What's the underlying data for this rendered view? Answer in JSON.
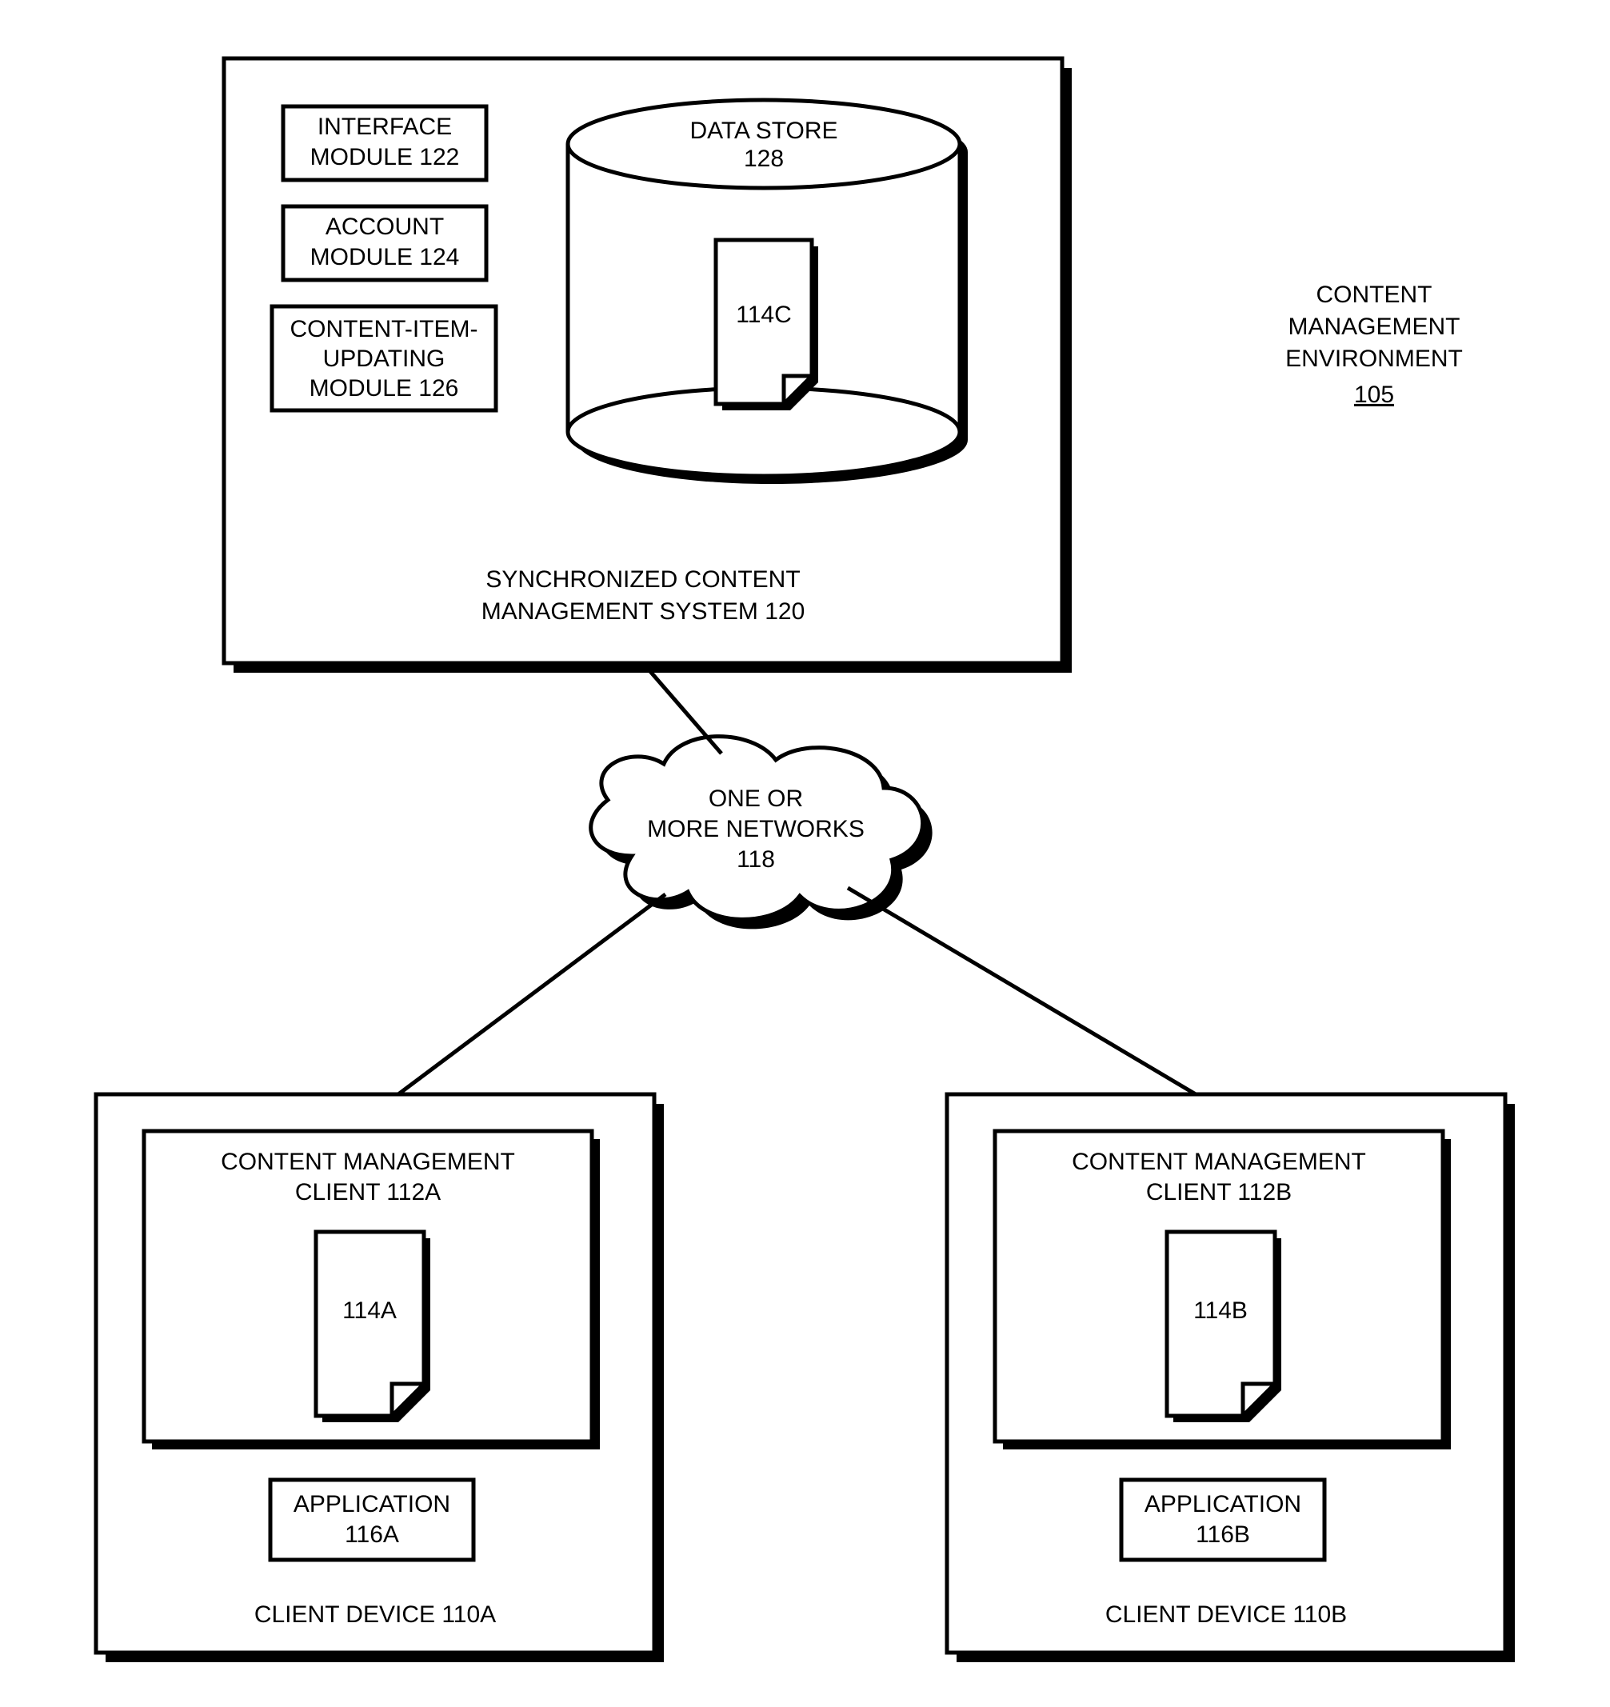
{
  "env": {
    "l1": "CONTENT",
    "l2": "MANAGEMENT",
    "l3": "ENVIRONMENT",
    "num": "105"
  },
  "scms": {
    "l1": "SYNCHRONIZED CONTENT",
    "l2": "MANAGEMENT SYSTEM 120"
  },
  "mod1": {
    "l1": "INTERFACE",
    "l2": "MODULE 122"
  },
  "mod2": {
    "l1": "ACCOUNT",
    "l2": "MODULE 124"
  },
  "mod3": {
    "l1": "CONTENT-ITEM-",
    "l2": "UPDATING",
    "l3": "MODULE 126"
  },
  "ds": {
    "l1": "DATA STORE",
    "l2": "128"
  },
  "fileC": "114C",
  "net": {
    "l1": "ONE OR",
    "l2": "MORE NETWORKS",
    "l3": "118"
  },
  "devA": {
    "label": "CLIENT DEVICE 110A",
    "client": {
      "l1": "CONTENT MANAGEMENT",
      "l2": "CLIENT 112A"
    },
    "file": "114A",
    "app": {
      "l1": "APPLICATION",
      "l2": "116A"
    }
  },
  "devB": {
    "label": "CLIENT DEVICE 110B",
    "client": {
      "l1": "CONTENT MANAGEMENT",
      "l2": "CLIENT 112B"
    },
    "file": "114B",
    "app": {
      "l1": "APPLICATION",
      "l2": "116B"
    }
  }
}
